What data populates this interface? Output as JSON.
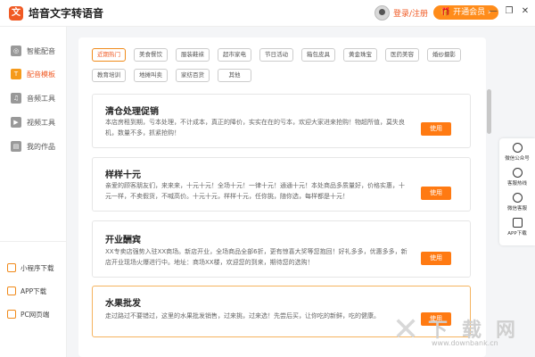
{
  "app": {
    "logo_glyph": "文",
    "title": "培音文字转语音"
  },
  "header": {
    "login_label": "登录/注册",
    "vip_label": "🎁 开通会员 ›",
    "min_glyph": "—",
    "max_glyph": "❐",
    "close_glyph": "✕"
  },
  "sidebar": {
    "items": [
      {
        "label": "智能配音",
        "icon": "mic-icon",
        "glyph": "◎"
      },
      {
        "label": "配音模板",
        "icon": "template-icon",
        "glyph": "T",
        "active": true
      },
      {
        "label": "音频工具",
        "icon": "audio-tool-icon",
        "glyph": "♫"
      },
      {
        "label": "视频工具",
        "icon": "video-tool-icon",
        "glyph": "▶"
      },
      {
        "label": "我的作品",
        "icon": "works-icon",
        "glyph": "▤"
      }
    ],
    "footer": [
      {
        "label": "小程序下载",
        "icon": "miniprogram-icon"
      },
      {
        "label": "APP下载",
        "icon": "app-download-icon"
      },
      {
        "label": "PC网页端",
        "icon": "pc-web-icon"
      }
    ]
  },
  "tags": [
    "近期热门",
    "美食餐饮",
    "服装鞋袜",
    "超市家电",
    "节日活动",
    "箱包皮具",
    "黄金珠宝",
    "医药美容",
    "婚纱摄影",
    "教育培训",
    "地摊叫卖",
    "家纺百货",
    "其他"
  ],
  "cards": [
    {
      "title": "清仓处理促销",
      "desc": "本店房租到期，亏本处理，不计成本，真正的降价，实实在在的亏本，欢迎大家进来抢购！物超所值，莫失良机，数量不多，抓紧抢购！",
      "button": "使用"
    },
    {
      "title": "样样十元",
      "desc": "亲爱的顾客朋友们，来来来，十元十元！全场十元！一律十元！通通十元！本处商品多质量好，价格实惠，十元一样，不卖假货，不喊高价。十元十元，样样十元，任你挑，随你选，每样都是十元！",
      "button": "使用"
    },
    {
      "title": "开业酬宾",
      "desc": "XX专卖店强势入驻XX商场。新店开业，全场商品全部6折，更有惊喜大奖等您抱回！好礼多多，优惠多多，新店开业现场火爆进行中。地址：商场XX楼，欢迎您的到来，期待您的选购！",
      "button": "使用"
    },
    {
      "title": "水果批发",
      "desc": "走过路过不要错过，这里的水果批发销售，过来挑，过来选！先尝后买，让你吃的新鲜，吃的健康。",
      "button": "使用"
    }
  ],
  "float_panel": [
    {
      "label": "微信公众号",
      "icon": "wechat-official-icon"
    },
    {
      "label": "客服热线",
      "icon": "phone-icon"
    },
    {
      "label": "微信客服",
      "icon": "wechat-service-icon"
    },
    {
      "label": "APP下载",
      "icon": "app-icon"
    }
  ],
  "watermark": {
    "glyph": "✕",
    "text": "下载网",
    "url": "www.downbank.cn"
  }
}
